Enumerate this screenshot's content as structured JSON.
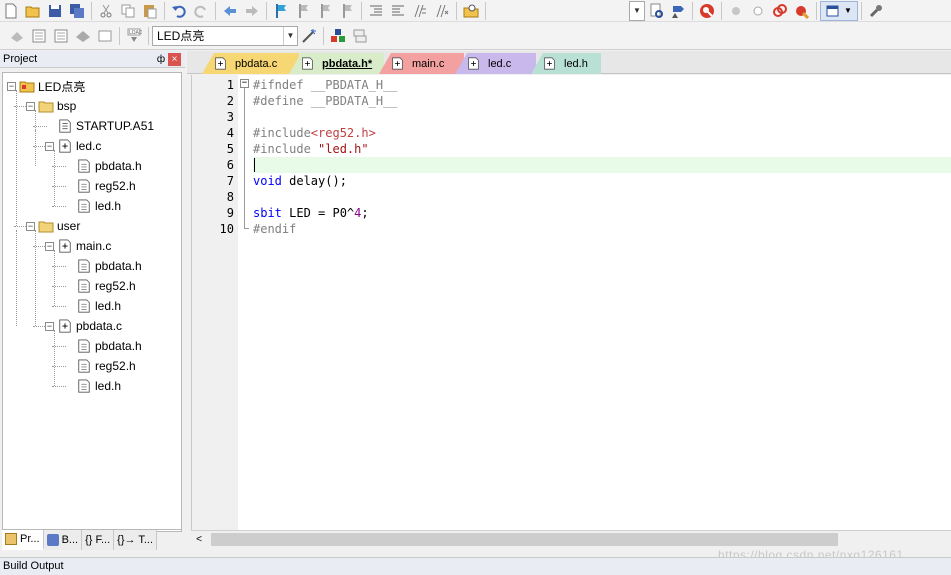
{
  "toolbar1": {
    "icons": [
      "new-file-icon",
      "open-folder-icon",
      "save-icon",
      "save-all-icon",
      "cut-icon",
      "copy-icon",
      "paste-icon",
      "undo-icon",
      "redo-icon",
      "nav-back-icon",
      "nav-forward-icon",
      "bookmark-icon",
      "prev-bookmark-icon",
      "next-bookmark-icon",
      "clear-bookmarks-icon",
      "indent-icon",
      "unindent-icon",
      "comment-icon",
      "uncomment-icon",
      "find-in-files-icon",
      "debug-icon",
      "start-debug-icon",
      "breakpoint-icon",
      "disable-breakpoint-icon",
      "kill-breakpoints-icon",
      "window-icon",
      "wrench-icon"
    ]
  },
  "toolbar2": {
    "target_select": "LED点亮"
  },
  "project": {
    "title": "Project",
    "pin": "ф",
    "close": "×",
    "tree": [
      {
        "label": "LED点亮",
        "type": "project"
      },
      {
        "label": "bsp",
        "type": "folder"
      },
      {
        "label": "STARTUP.A51",
        "type": "file"
      },
      {
        "label": "led.c",
        "type": "cfile"
      },
      {
        "label": "pbdata.h",
        "type": "header"
      },
      {
        "label": "reg52.h",
        "type": "header"
      },
      {
        "label": "led.h",
        "type": "header"
      },
      {
        "label": "user",
        "type": "folder"
      },
      {
        "label": "main.c",
        "type": "cfile"
      },
      {
        "label": "pbdata.h",
        "type": "header"
      },
      {
        "label": "reg52.h",
        "type": "header"
      },
      {
        "label": "led.h",
        "type": "header"
      },
      {
        "label": "pbdata.c",
        "type": "cfile"
      },
      {
        "label": "pbdata.h",
        "type": "header"
      },
      {
        "label": "reg52.h",
        "type": "header"
      },
      {
        "label": "led.h",
        "type": "header"
      }
    ],
    "bottom_tabs": [
      "Pr...",
      "B...",
      "{} F...",
      "{}→ T..."
    ]
  },
  "editor": {
    "tabs": [
      {
        "label": "pbdata.c",
        "color": "#f7d774"
      },
      {
        "label": "pbdata.h*",
        "color": "#d8ecc9",
        "active": true
      },
      {
        "label": "main.c",
        "color": "#f2a0a0"
      },
      {
        "label": "led.c",
        "color": "#c9b8ec"
      },
      {
        "label": "led.h",
        "color": "#b8e0d4"
      }
    ],
    "line_numbers": [
      "1",
      "2",
      "3",
      "4",
      "5",
      "6",
      "7",
      "8",
      "9",
      "10"
    ],
    "lines": [
      [
        {
          "t": "#ifndef __PBDATA_H__",
          "c": "pp"
        }
      ],
      [
        {
          "t": "#define __PBDATA_H__",
          "c": "pp"
        }
      ],
      [
        {
          "t": "",
          "c": ""
        }
      ],
      [
        {
          "t": "#include",
          "c": "pp"
        },
        {
          "t": "<reg52.h>",
          "c": "inc"
        }
      ],
      [
        {
          "t": "#include ",
          "c": "pp"
        },
        {
          "t": "\"led.h\"",
          "c": "str"
        }
      ],
      [
        {
          "t": "",
          "c": ""
        }
      ],
      [
        {
          "t": "void",
          "c": "kw"
        },
        {
          "t": " delay();",
          "c": ""
        }
      ],
      [
        {
          "t": "",
          "c": ""
        }
      ],
      [
        {
          "t": "sbit",
          "c": "kw"
        },
        {
          "t": " LED = P0^",
          "c": ""
        },
        {
          "t": "4",
          "c": "num"
        },
        {
          "t": ";",
          "c": ""
        }
      ],
      [
        {
          "t": "#endif",
          "c": "pp"
        }
      ]
    ],
    "current_line": 6,
    "scroll_left_arrow": "<"
  },
  "watermark": "https://blog.csdn.net/nxg126161",
  "statusbar": {
    "label": "Build Output"
  }
}
